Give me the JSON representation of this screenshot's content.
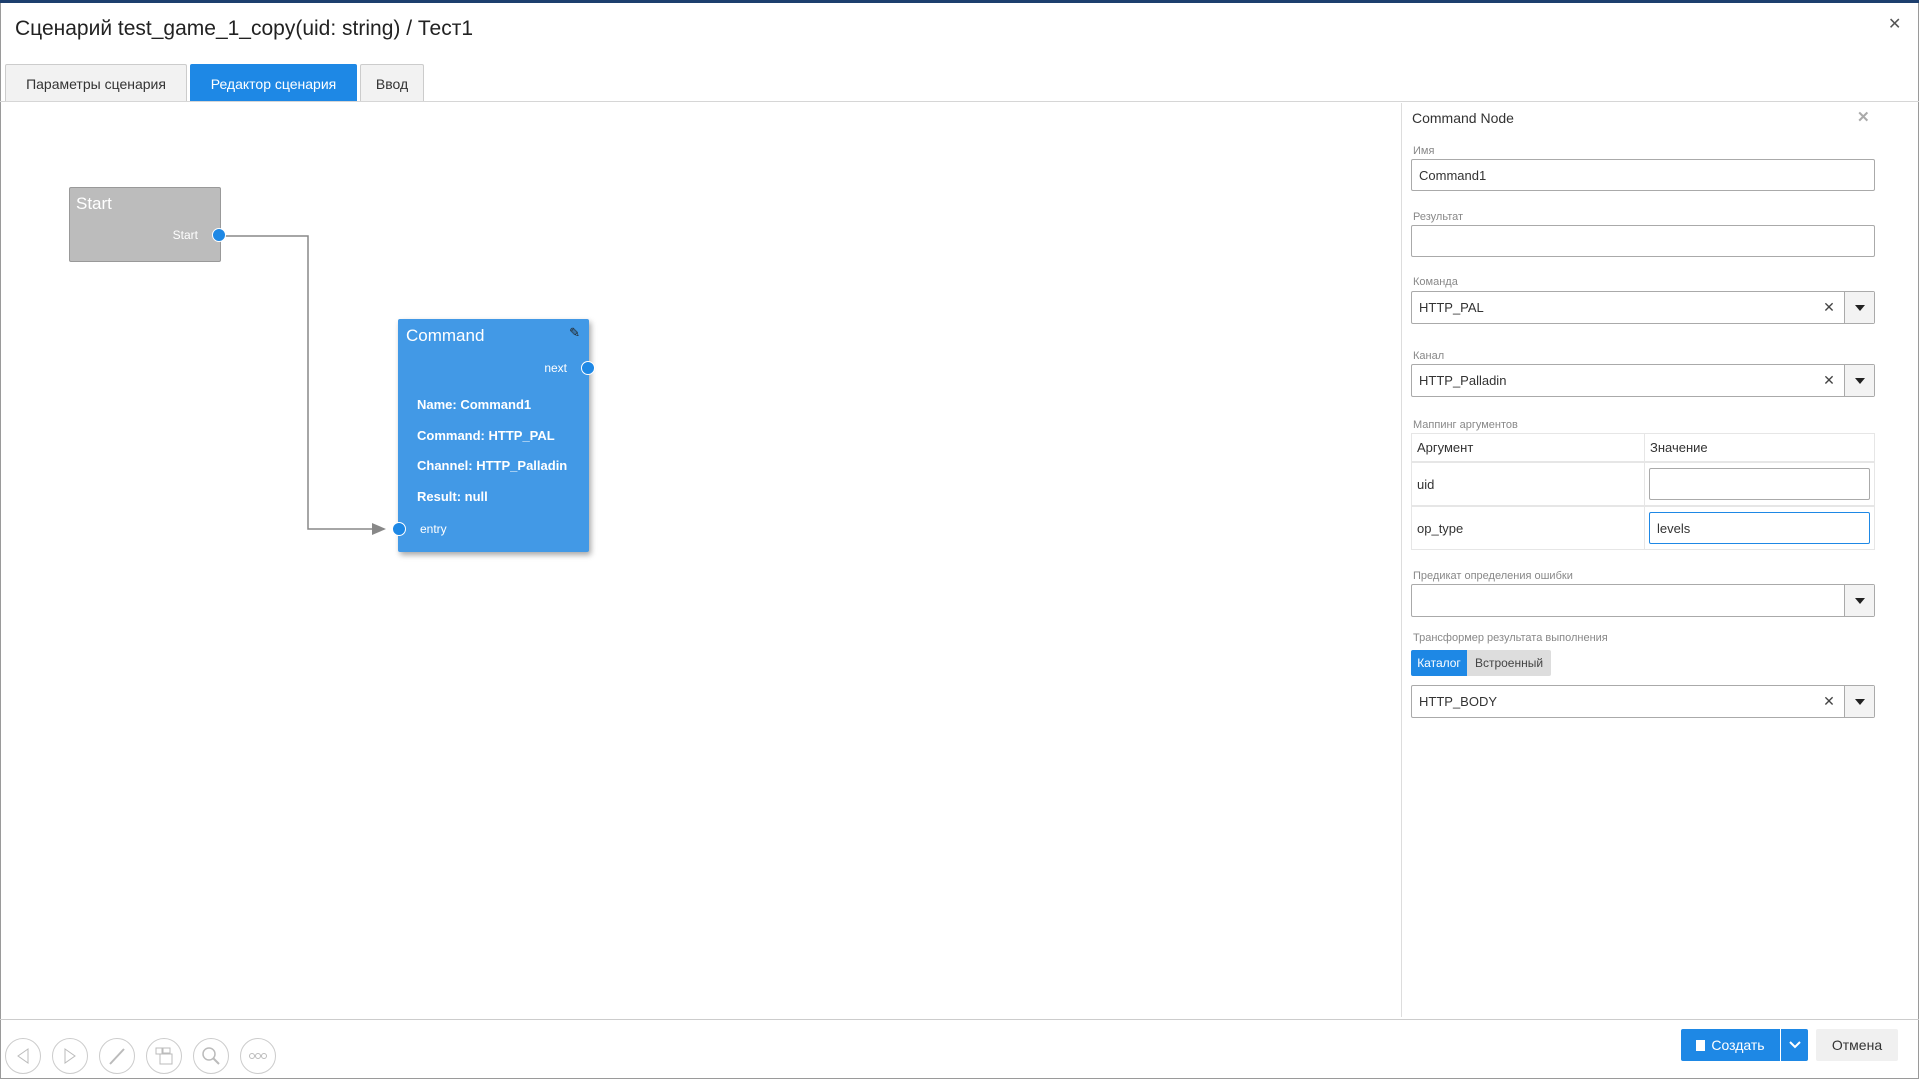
{
  "window": {
    "title": "Сценарий test_game_1_copy(uid: string) / Тест1",
    "close_icon": "close-icon"
  },
  "tabs": [
    {
      "label": "Параметры сценария",
      "active": false
    },
    {
      "label": "Редактор сценария",
      "active": true
    },
    {
      "label": "Ввод",
      "active": false
    }
  ],
  "canvas": {
    "start_node": {
      "title": "Start",
      "port_label": "Start"
    },
    "command_node": {
      "title": "Command",
      "next_label": "next",
      "entry_label": "entry",
      "lines": [
        "Name: Command1",
        "Command: HTTP_PAL",
        "Channel: HTTP_Palladin",
        "Result: null"
      ]
    }
  },
  "toolbar": {
    "icons": [
      "arrow-left-icon",
      "arrow-right-icon",
      "brush-icon",
      "layout-icon",
      "search-icon",
      "more-icon"
    ]
  },
  "panel": {
    "title": "Command Node",
    "name_label": "Имя",
    "name_value": "Command1",
    "result_label": "Результат",
    "result_value": "",
    "command_label": "Команда",
    "command_value": "HTTP_PAL",
    "channel_label": "Канал",
    "channel_value": "HTTP_Palladin",
    "mapping_label": "Маппинг аргументов",
    "mapping": {
      "headers": [
        "Аргумент",
        "Значение"
      ],
      "rows": [
        {
          "arg": "uid",
          "value": ""
        },
        {
          "arg": "op_type",
          "value": "levels"
        }
      ]
    },
    "predicate_label": "Предикат определения ошибки",
    "predicate_value": "",
    "transformer_label": "Трансформер результата выполнения",
    "transformer_toggle": [
      {
        "label": "Каталог",
        "active": true
      },
      {
        "label": "Встроенный",
        "active": false
      }
    ],
    "transformer_value": "HTTP_BODY"
  },
  "footer": {
    "create_label": "Создать",
    "cancel_label": "Отмена"
  },
  "colors": {
    "accent": "#1e88e5",
    "node_blue": "#4299e6",
    "start_gray": "#bcbcbc"
  }
}
